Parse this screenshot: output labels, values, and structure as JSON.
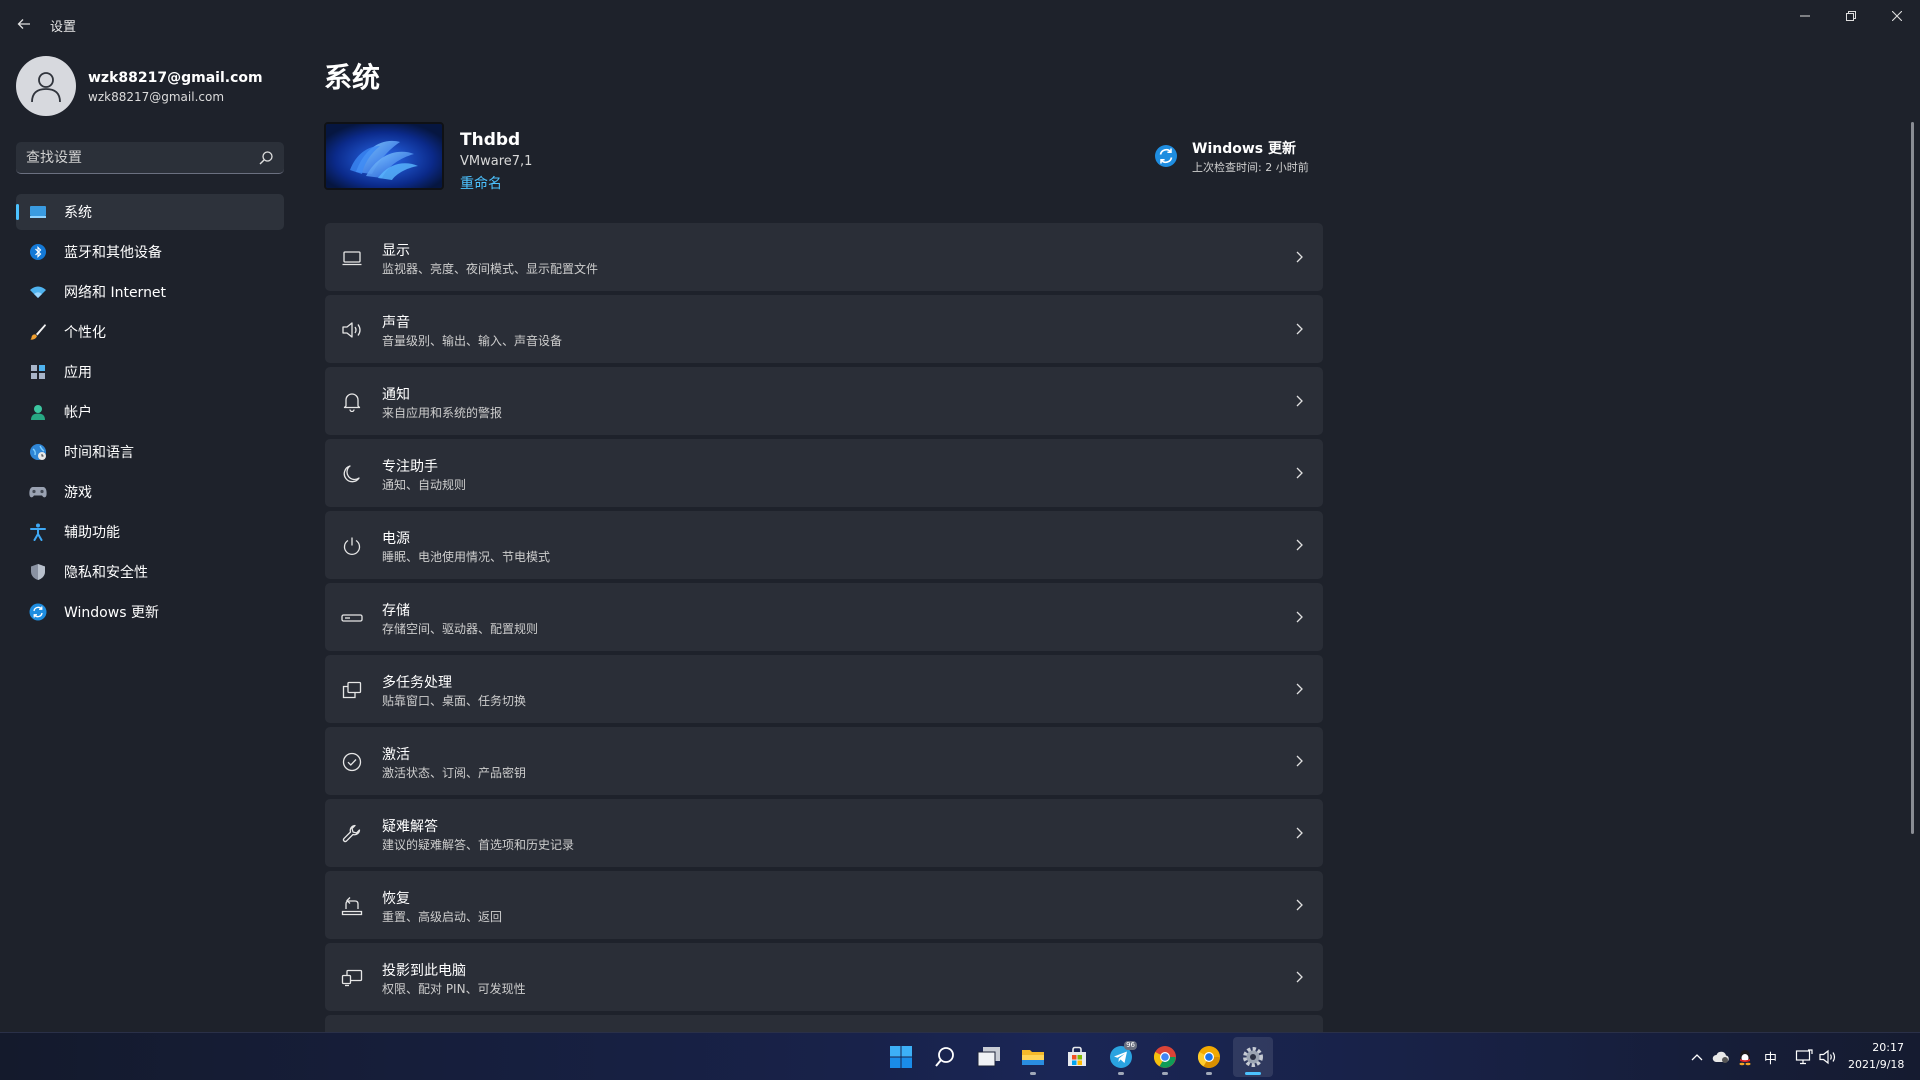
{
  "window": {
    "app_title": "设置",
    "controls": [
      "minimize",
      "restore",
      "close"
    ]
  },
  "profile": {
    "name": "wzk88217@gmail.com",
    "email": "wzk88217@gmail.com"
  },
  "search": {
    "placeholder": "查找设置"
  },
  "sidebar": {
    "items": [
      {
        "label": "系统",
        "icon": "system-icon",
        "active": true
      },
      {
        "label": "蓝牙和其他设备",
        "icon": "bluetooth-icon"
      },
      {
        "label": "网络和 Internet",
        "icon": "wifi-icon"
      },
      {
        "label": "个性化",
        "icon": "brush-icon"
      },
      {
        "label": "应用",
        "icon": "apps-icon"
      },
      {
        "label": "帐户",
        "icon": "account-icon"
      },
      {
        "label": "时间和语言",
        "icon": "globe-clock-icon"
      },
      {
        "label": "游戏",
        "icon": "gamepad-icon"
      },
      {
        "label": "辅助功能",
        "icon": "accessibility-icon"
      },
      {
        "label": "隐私和安全性",
        "icon": "shield-icon"
      },
      {
        "label": "Windows 更新",
        "icon": "update-icon"
      }
    ]
  },
  "main": {
    "title": "系统",
    "device": {
      "name": "Thdbd",
      "model": "VMware7,1",
      "rename": "重命名"
    },
    "update": {
      "title": "Windows 更新",
      "subtitle": "上次检查时间: 2 小时前"
    },
    "settings": [
      {
        "title": "显示",
        "subtitle": "监视器、亮度、夜间模式、显示配置文件",
        "icon": "monitor-icon"
      },
      {
        "title": "声音",
        "subtitle": "音量级别、输出、输入、声音设备",
        "icon": "speaker-icon"
      },
      {
        "title": "通知",
        "subtitle": "来自应用和系统的警报",
        "icon": "bell-icon"
      },
      {
        "title": "专注助手",
        "subtitle": "通知、自动规则",
        "icon": "moon-icon"
      },
      {
        "title": "电源",
        "subtitle": "睡眠、电池使用情况、节电模式",
        "icon": "power-icon"
      },
      {
        "title": "存储",
        "subtitle": "存储空间、驱动器、配置规则",
        "icon": "storage-icon"
      },
      {
        "title": "多任务处理",
        "subtitle": "贴靠窗口、桌面、任务切换",
        "icon": "multitask-icon"
      },
      {
        "title": "激活",
        "subtitle": "激活状态、订阅、产品密钥",
        "icon": "check-circle-icon"
      },
      {
        "title": "疑难解答",
        "subtitle": "建议的疑难解答、首选项和历史记录",
        "icon": "wrench-icon"
      },
      {
        "title": "恢复",
        "subtitle": "重置、高级启动、返回",
        "icon": "recovery-icon"
      },
      {
        "title": "投影到此电脑",
        "subtitle": "权限、配对 PIN、可发现性",
        "icon": "project-icon"
      }
    ]
  },
  "taskbar": {
    "apps": [
      "start-icon",
      "search-icon",
      "task-view-icon",
      "file-explorer-icon",
      "store-icon",
      "telegram-icon",
      "chrome-icon",
      "chrome-canary-icon",
      "settings-gear-icon"
    ],
    "telegram_badge": "96",
    "ime": "中",
    "time": "20:17",
    "date": "2021/9/18"
  },
  "colors": {
    "accent": "#4cc2ff",
    "background": "#1e222b",
    "card": "#2a2e37"
  }
}
